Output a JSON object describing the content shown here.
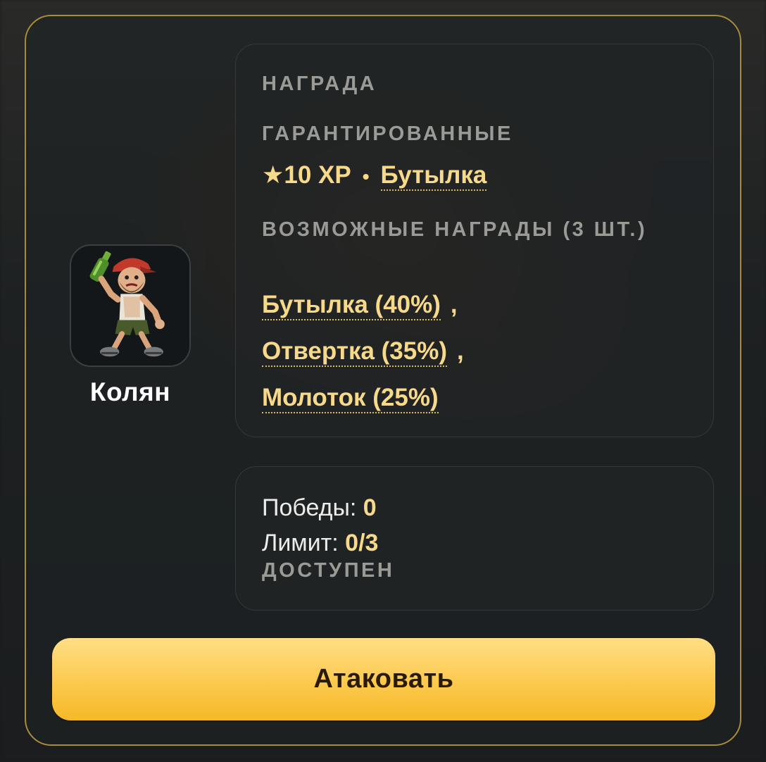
{
  "enemy": {
    "name": "Колян",
    "portrait_icon": "drunk-hobo-with-bottle-portrait"
  },
  "reward": {
    "title": "НАГРАДА",
    "guaranteed_label": "ГАРАНТИРОВАННЫЕ",
    "guaranteed_xp": "★10 XP",
    "separator": "•",
    "guaranteed_item": "Бутылка",
    "possible_label": "ВОЗМОЖНЫЕ НАГРАДЫ (3 ШТ.)",
    "possible_items": [
      {
        "label": "Бутылка (40%)",
        "suffix": ","
      },
      {
        "label": "Отвертка (35%)",
        "suffix": ","
      },
      {
        "label": "Молоток (25%)",
        "suffix": ""
      }
    ]
  },
  "stats": {
    "wins_label": "Победы:",
    "wins_value": "0",
    "limit_label": "Лимит:",
    "limit_value": "0/3",
    "status": "ДОСТУПЕН"
  },
  "actions": {
    "attack_label": "Атаковать"
  },
  "colors": {
    "accent_gold": "#f7d98c",
    "button_gold": "#fcc94d",
    "card_border": "#a88a3e"
  }
}
